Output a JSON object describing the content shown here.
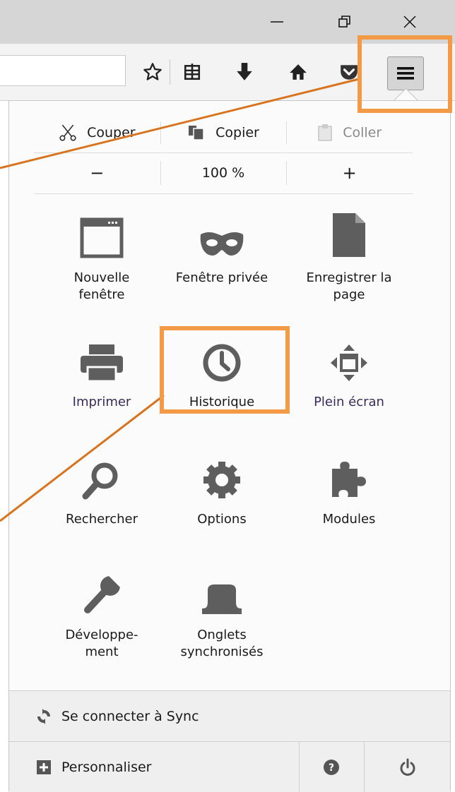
{
  "window": {
    "minimize_icon": "minimize-icon",
    "restore_icon": "restore-icon",
    "close_icon": "close-icon"
  },
  "toolbar": {
    "icons": [
      "bookmark-star-icon",
      "reading-list-icon",
      "download-icon",
      "home-icon",
      "pocket-icon"
    ],
    "menu_icon": "hamburger-menu-icon"
  },
  "edit": {
    "cut": "Couper",
    "copy": "Copier",
    "paste": "Coller"
  },
  "zoom": {
    "minus": "−",
    "level": "100 %",
    "plus": "+"
  },
  "tiles": [
    {
      "label": "Nouvelle\nfenêtre",
      "icon": "new-window-icon"
    },
    {
      "label": "Fenêtre privée",
      "icon": "private-mask-icon"
    },
    {
      "label": "Enregistrer la\npage",
      "icon": "save-page-icon"
    },
    {
      "label": "Imprimer",
      "icon": "printer-icon"
    },
    {
      "label": "Historique",
      "icon": "clock-icon"
    },
    {
      "label": "Plein écran",
      "icon": "fullscreen-icon"
    },
    {
      "label": "Rechercher",
      "icon": "search-icon"
    },
    {
      "label": "Options",
      "icon": "gear-icon"
    },
    {
      "label": "Modules",
      "icon": "puzzle-icon"
    },
    {
      "label": "Développe-\nment",
      "icon": "wrench-icon"
    },
    {
      "label": "Onglets\nsynchronisés",
      "icon": "synced-tabs-icon"
    }
  ],
  "footer": {
    "sync": "Se connecter à Sync",
    "customize": "Personnaliser",
    "help_icon": "help-icon",
    "quit_icon": "power-icon"
  },
  "annotation": {
    "color": "#F29A46",
    "line_color": "#D9731E"
  }
}
